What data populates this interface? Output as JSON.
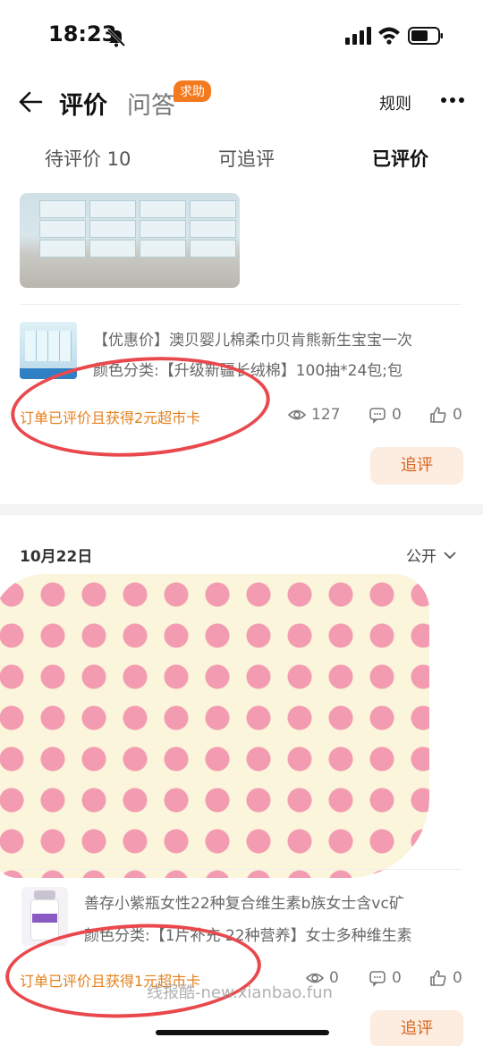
{
  "status_bar": {
    "time": "18:23"
  },
  "nav": {
    "title": "评价",
    "qa_tab": "问答",
    "qa_badge": "求助",
    "rules": "规则"
  },
  "tabs": [
    {
      "label": "待评价 10"
    },
    {
      "label": "可追评"
    },
    {
      "label": "已评价"
    }
  ],
  "reviews": [
    {
      "product_line1": "【优惠价】澳贝婴儿棉柔巾贝肯熊新生宝宝一次",
      "product_line2": "颜色分类:【升级新疆长绒棉】100抽*24包;包",
      "reward": "订单已评价且获得2元超市卡",
      "views": "127",
      "comments": "0",
      "likes": "0",
      "follow_label": "追评"
    },
    {
      "date": "10月22日",
      "visibility": "公开",
      "product_line1": "善存小紫瓶女性22种复合维生素b族女士含vc矿",
      "product_line2": "颜色分类:【1片补充 22种营养】女士多种维生素",
      "reward": "订单已评价且获得1元超市卡",
      "views": "0",
      "comments": "0",
      "likes": "0",
      "follow_label": "追评"
    }
  ],
  "watermark": "线报酷-new.xianbao.fun",
  "colors": {
    "accent": "#e4801b",
    "badge": "#f47a20",
    "annotation": "#e9494d"
  }
}
